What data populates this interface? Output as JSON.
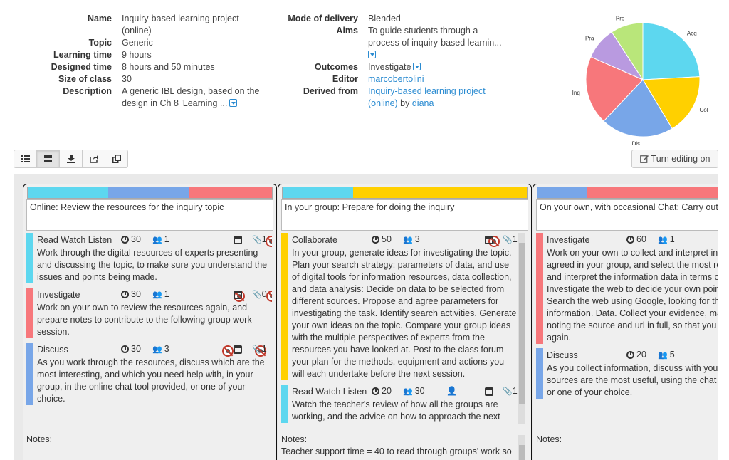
{
  "meta_left": [
    {
      "label": "Name",
      "value": "Inquiry-based learning project (online)"
    },
    {
      "label": "Topic",
      "value": "Generic"
    },
    {
      "label": "Learning time",
      "value": "9 hours"
    },
    {
      "label": "Designed time",
      "value": "8 hours and 50 minutes"
    },
    {
      "label": "Size of class",
      "value": "30"
    },
    {
      "label": "Description",
      "value": "A generic IBL design, based on the design in Ch 8 'Learning ..."
    }
  ],
  "meta_right": {
    "mode_label": "Mode of delivery",
    "mode_value": "Blended",
    "aims_label": "Aims",
    "aims_value": "To guide students through a process of inquiry-based learnin...",
    "outcomes_label": "Outcomes",
    "outcomes_value": "Investigate",
    "editor_label": "Editor",
    "editor_value": "marcobertolini",
    "derived_label": "Derived from",
    "derived_link": "Inquiry-based learning project (online)",
    "derived_by": "by",
    "derived_author": "diana"
  },
  "pie": {
    "labels": [
      "Acq",
      "Col",
      "Dis",
      "Inq",
      "Pra",
      "Pro"
    ],
    "values": [
      21,
      15,
      18,
      17,
      8,
      8
    ],
    "colors": [
      "#5dd7ef",
      "#ffd000",
      "#78a6e8",
      "#f7777b",
      "#b99ae0",
      "#b9e67a"
    ]
  },
  "toolbar": {
    "icons": [
      "list-view-icon",
      "grid-view-icon",
      "download-icon",
      "share-icon",
      "duplicate-icon"
    ],
    "edit_label": "Turn editing on"
  },
  "columns": [
    {
      "bar": [
        {
          "color": "#5dd7ef",
          "share": 0.33
        },
        {
          "color": "#78a6e8",
          "share": 0.33
        },
        {
          "color": "#f7777b",
          "share": 0.34
        }
      ],
      "title": "Online: Review the resources for the inquiry topic",
      "activities": [
        {
          "name": "Read Watch Listen",
          "color": "#5dd7ef",
          "time": "30",
          "group": "1",
          "files": "1",
          "desc": "Work through the digital resources of experts presenting and discussing the topic, to make sure you understand the issues and points being made."
        },
        {
          "name": "Investigate",
          "color": "#f7777b",
          "time": "30",
          "group": "1",
          "files": "0",
          "desc": "Work on your own to review the resources again, and prepare notes to contribute to the following group work session."
        },
        {
          "name": "Discuss",
          "color": "#78a6e8",
          "time": "30",
          "group": "3",
          "files": "1",
          "desc": "As you work through the resources, discuss which are the most interesting, and which you need help with, in your group, in the online chat tool provided, or one of your choice."
        }
      ],
      "notes_label": "Notes:",
      "notes_text": ""
    },
    {
      "bar": [
        {
          "color": "#5dd7ef",
          "share": 0.29
        },
        {
          "color": "#ffd000",
          "share": 0.71
        }
      ],
      "title": "In your group: Prepare for doing the inquiry",
      "activities": [
        {
          "name": "Collaborate",
          "color": "#ffd000",
          "time": "50",
          "group": "3",
          "files": "1",
          "desc": "In your group, generate ideas for investigating the topic. Plan your search strategy: parameters of data, and use of digital tools for information resources, data collection, and data analysis: Decide on data to be selected from different sources. Propose and agree parameters for investigating the task. Identify search activities. Generate your own ideas on the topic. Compare your group ideas with the multiple perspectives of experts from the resources you have looked at. Post to the class forum your plan for the methods, equipment and actions you will each undertake before the next session."
        },
        {
          "name": "Read Watch Listen",
          "color": "#5dd7ef",
          "time": "20",
          "group": "30",
          "files": "1",
          "desc": "Watch the teacher's review of how all the groups are working, and the advice on how to approach the next"
        }
      ],
      "notes_label": "Notes:",
      "notes_text": "Teacher support time = 40 to read through groups' work so"
    },
    {
      "bar": [
        {
          "color": "#78a6e8",
          "share": 0.29
        },
        {
          "color": "#f7777b",
          "share": 0.71
        }
      ],
      "title": "On your own, with occasional Chat: Carry out the inquiry",
      "activities": [
        {
          "name": "Investigate",
          "color": "#f7777b",
          "time": "60",
          "group": "1",
          "files": "",
          "desc": "Work on your own to collect and interpret information agreed in your group, and select the most relevant: Collect and interpret the information data in terms of your topic. Investigate the web to decide your own point of view. Search the web using Google, looking for the most relevant information. Data. Collect your evidence, making notes and noting the source and url in full, so that you can find it again."
        },
        {
          "name": "Discuss",
          "color": "#78a6e8",
          "time": "20",
          "group": "5",
          "files": "",
          "desc": "As you collect information, discuss with your group which sources are the most useful, using the chat tool provided, or one of your choice."
        }
      ],
      "notes_label": "Notes:",
      "notes_text": ""
    }
  ]
}
